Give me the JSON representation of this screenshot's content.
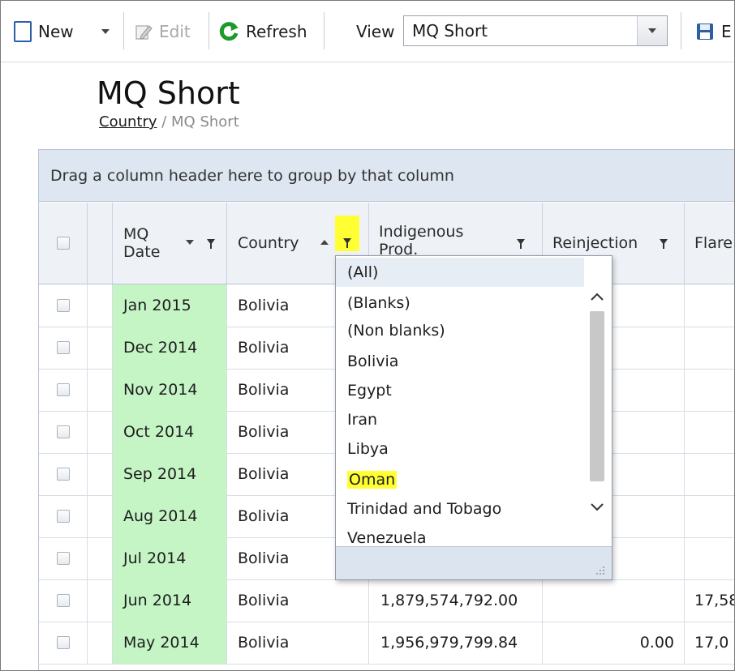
{
  "toolbar": {
    "new_label": "New",
    "edit_label": "Edit",
    "refresh_label": "Refresh",
    "view_label": "View",
    "view_value": "MQ Short",
    "export_label": "E"
  },
  "page": {
    "title": "MQ Short",
    "breadcrumb_link": "Country",
    "breadcrumb_sep": " / ",
    "breadcrumb_current": "MQ Short"
  },
  "grid": {
    "group_hint": "Drag a column header here to group by that column",
    "columns": {
      "mq_date_line1": "MQ",
      "mq_date_line2": "Date",
      "country": "Country",
      "indigenous_line1": "Indigenous",
      "indigenous_line2": "Prod.",
      "reinjection": "Reinjection",
      "flare": "Flare"
    },
    "rows": [
      {
        "date": "Jan 2015",
        "country": "Bolivia",
        "indigenous": "",
        "reinjection": "",
        "flare": ""
      },
      {
        "date": "Dec 2014",
        "country": "Bolivia",
        "indigenous": "",
        "reinjection": "",
        "flare": ""
      },
      {
        "date": "Nov 2014",
        "country": "Bolivia",
        "indigenous": "",
        "reinjection": "",
        "flare": ""
      },
      {
        "date": "Oct 2014",
        "country": "Bolivia",
        "indigenous": "",
        "reinjection": "",
        "flare": ""
      },
      {
        "date": "Sep 2014",
        "country": "Bolivia",
        "indigenous": "",
        "reinjection": "",
        "flare": ""
      },
      {
        "date": "Aug 2014",
        "country": "Bolivia",
        "indigenous": "",
        "reinjection": "",
        "flare": ""
      },
      {
        "date": "Jul 2014",
        "country": "Bolivia",
        "indigenous": "",
        "reinjection": "",
        "flare": ""
      },
      {
        "date": "Jun 2014",
        "country": "Bolivia",
        "indigenous": "1,879,574,792.00",
        "reinjection": "",
        "flare": "17,58"
      },
      {
        "date": "May 2014",
        "country": "Bolivia",
        "indigenous": "1,956,979,799.84",
        "reinjection": "0.00",
        "flare": "17,0"
      }
    ]
  },
  "filter_dropdown": {
    "items": [
      "(All)",
      "(Blanks)",
      "(Non blanks)",
      "Bolivia",
      "Egypt",
      "Iran",
      "Libya",
      "Oman",
      "Trinidad and Tobago",
      "Venezuela"
    ],
    "selected": "(All)",
    "highlighted": "Oman"
  },
  "colors": {
    "date_cell_bg": "#c5f5c5",
    "highlight": "#ffff33",
    "group_panel_bg": "#dde6f1",
    "header_bg": "#eef2f7"
  }
}
